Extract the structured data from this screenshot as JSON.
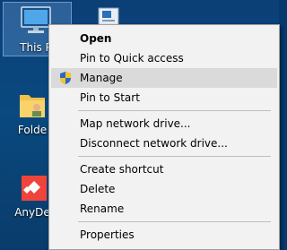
{
  "desktop": {
    "icons": [
      {
        "name": "this-pc",
        "label": "This P"
      },
      {
        "name": "folder",
        "label": "Folde"
      },
      {
        "name": "anydesk",
        "label": "AnyDe"
      }
    ]
  },
  "context_menu": {
    "items": [
      {
        "label": "Open",
        "bold": true
      },
      {
        "label": "Pin to Quick access"
      },
      {
        "label": "Manage",
        "icon": "uac-shield-icon",
        "highlighted": true
      },
      {
        "label": "Pin to Start"
      },
      {
        "label": "Map network drive..."
      },
      {
        "label": "Disconnect network drive..."
      },
      {
        "label": "Create shortcut"
      },
      {
        "label": "Delete"
      },
      {
        "label": "Rename"
      },
      {
        "label": "Properties"
      }
    ]
  },
  "colors": {
    "desktop": "#09497f",
    "menu_bg": "#f2f2f2",
    "menu_hover": "#dadada",
    "separator": "#bdbdbd"
  }
}
